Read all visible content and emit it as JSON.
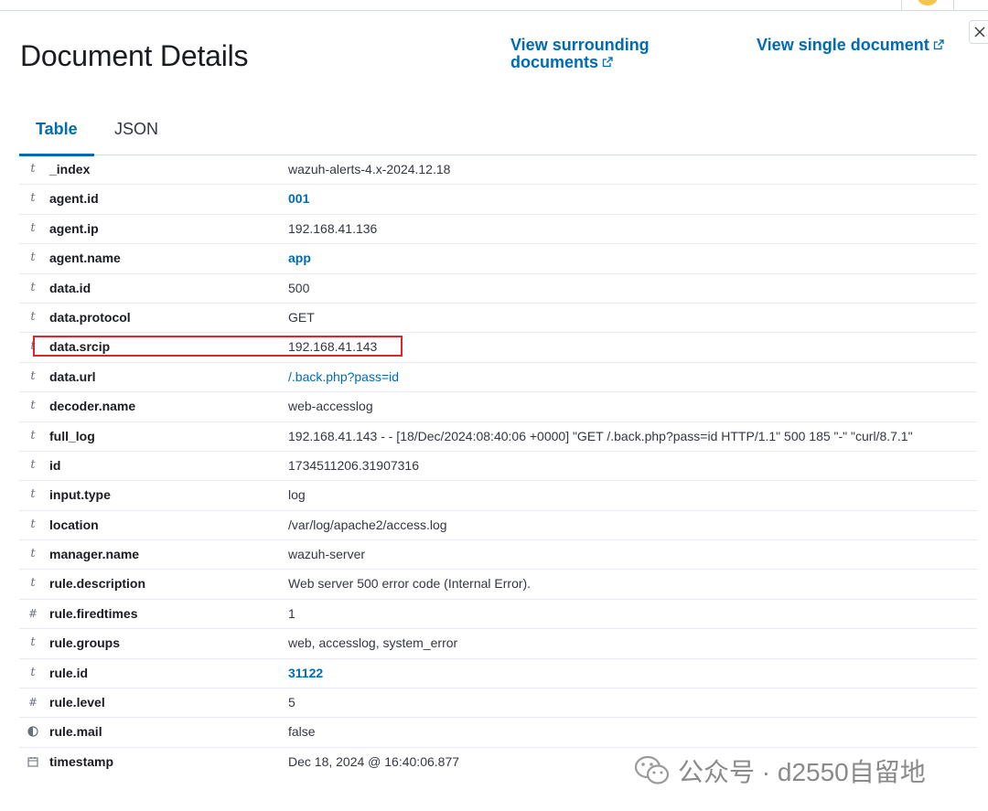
{
  "header": {
    "title": "Document Details",
    "view_surrounding": "View surrounding documents",
    "view_single": "View single document"
  },
  "tabs": [
    {
      "label": "Table"
    },
    {
      "label": "JSON"
    }
  ],
  "rows": [
    {
      "type": "t",
      "field": "_index",
      "value": "wazuh-alerts-4.x-2024.12.18"
    },
    {
      "type": "t",
      "field": "agent.id",
      "value": "001"
    },
    {
      "type": "t",
      "field": "agent.ip",
      "value": "192.168.41.136"
    },
    {
      "type": "t",
      "field": "agent.name",
      "value": "app"
    },
    {
      "type": "t",
      "field": "data.id",
      "value": "500"
    },
    {
      "type": "t",
      "field": "data.protocol",
      "value": "GET"
    },
    {
      "type": "t",
      "field": "data.srcip",
      "value": "192.168.41.143"
    },
    {
      "type": "t",
      "field": "data.url",
      "value": "/.back.php?pass=id"
    },
    {
      "type": "t",
      "field": "decoder.name",
      "value": "web-accesslog"
    },
    {
      "type": "t",
      "field": "full_log",
      "value": "192.168.41.143 - - [18/Dec/2024:08:40:06 +0000] \"GET /.back.php?pass=id HTTP/1.1\" 500 185 \"-\" \"curl/8.7.1\""
    },
    {
      "type": "t",
      "field": "id",
      "value": "1734511206.31907316"
    },
    {
      "type": "t",
      "field": "input.type",
      "value": "log"
    },
    {
      "type": "t",
      "field": "location",
      "value": "/var/log/apache2/access.log"
    },
    {
      "type": "t",
      "field": "manager.name",
      "value": "wazuh-server"
    },
    {
      "type": "t",
      "field": "rule.description",
      "value": "Web server 500 error code (Internal Error)."
    },
    {
      "type": "#",
      "field": "rule.firedtimes",
      "value": "1"
    },
    {
      "type": "t",
      "field": "rule.groups",
      "value": "web, accesslog, system_error"
    },
    {
      "type": "t",
      "field": "rule.id",
      "value": "31122"
    },
    {
      "type": "#",
      "field": "rule.level",
      "value": "5"
    },
    {
      "type": "boolean",
      "field": "rule.mail",
      "value": "false"
    },
    {
      "type": "date",
      "field": "timestamp",
      "value": "Dec 18, 2024 @ 16:40:06.877"
    }
  ],
  "watermark": {
    "text": "公众号 · d2550自留地"
  },
  "colors": {
    "accent": "#006bb4",
    "highlight_box": "#e0252a"
  }
}
